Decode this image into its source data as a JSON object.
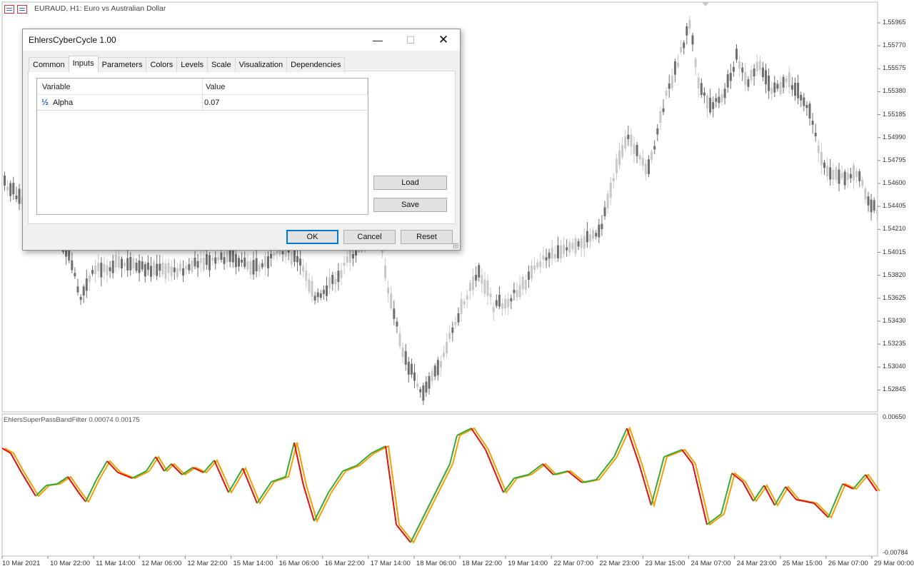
{
  "chart": {
    "title": "EURAUD, H1:  Euro vs Australian Dollar",
    "price_axis": [
      "1.55965",
      "1.55770",
      "1.55575",
      "1.55380",
      "1.55185",
      "1.54990",
      "1.54795",
      "1.54600",
      "1.54405",
      "1.54210",
      "1.54015",
      "1.53820",
      "1.53625",
      "1.53430",
      "1.53235",
      "1.53040",
      "1.52845"
    ],
    "indicator_label": "EhlersSuperPassBandFilter 0.00074 0.00175",
    "indicator_axis": [
      "0.00650",
      "-0.00784"
    ],
    "time_axis": [
      "10 Mar 2021",
      "10 Mar 22:00",
      "11 Mar 14:00",
      "12 Mar 06:00",
      "12 Mar 22:00",
      "15 Mar 14:00",
      "16 Mar 06:00",
      "16 Mar 22:00",
      "17 Mar 14:00",
      "18 Mar 06:00",
      "18 Mar 22:00",
      "19 Mar 14:00",
      "22 Mar 07:00",
      "22 Mar 23:00",
      "23 Mar 15:00",
      "24 Mar 07:00",
      "24 Mar 23:00",
      "25 Mar 15:00",
      "26 Mar 07:00",
      "29 Mar 00:00"
    ],
    "colors": {
      "candle_up": "#c8c8c8",
      "candle_down": "#6e6e6e",
      "line_up": "#39a83a",
      "line_down": "#e01010",
      "signal": "#f5a000"
    }
  },
  "dialog": {
    "title": "EhlersCyberCycle 1.00",
    "tabs": [
      "Common",
      "Inputs",
      "Parameters",
      "Colors",
      "Levels",
      "Scale",
      "Visualization",
      "Dependencies"
    ],
    "active_tab": "Inputs",
    "table": {
      "headers": [
        "Variable",
        "Value"
      ],
      "rows": [
        {
          "icon": "½",
          "name": "Alpha",
          "value": "0.07"
        }
      ]
    },
    "buttons": {
      "load": "Load",
      "save": "Save",
      "ok": "OK",
      "cancel": "Cancel",
      "reset": "Reset"
    }
  }
}
